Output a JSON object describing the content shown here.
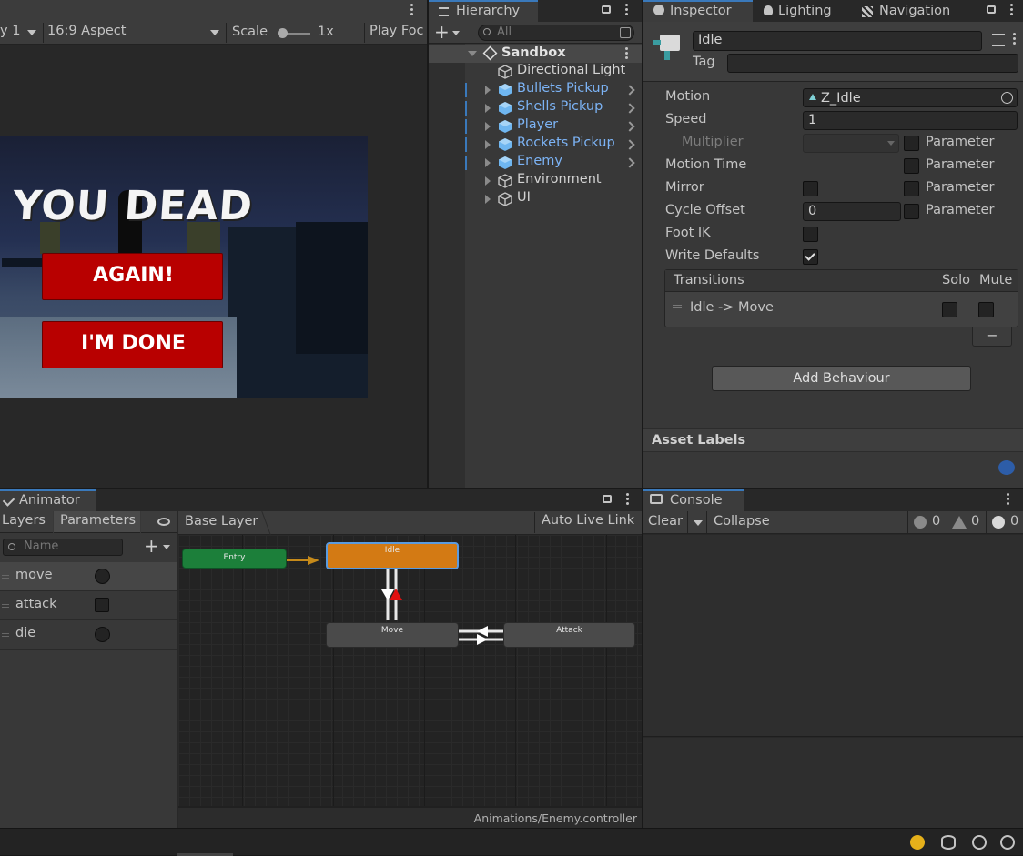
{
  "game_view": {
    "display_label": "y 1",
    "aspect_label": "16:9 Aspect",
    "scale_label": "Scale",
    "scale_value": "1x",
    "play_focus_label": "Play Foc",
    "title_text": "YOU DEAD",
    "again_label": "AGAIN!",
    "done_label": "I'M DONE"
  },
  "hierarchy": {
    "tab_label": "Hierarchy",
    "search_placeholder": "All",
    "scene_name": "Sandbox",
    "items": [
      {
        "label": "Directional Light",
        "prefab": false,
        "expandable": false,
        "chevron": false
      },
      {
        "label": "Bullets Pickup",
        "prefab": true,
        "expandable": true,
        "chevron": true
      },
      {
        "label": "Shells Pickup",
        "prefab": true,
        "expandable": true,
        "chevron": true
      },
      {
        "label": "Player",
        "prefab": true,
        "expandable": true,
        "chevron": true
      },
      {
        "label": "Rockets Pickup",
        "prefab": true,
        "expandable": true,
        "chevron": true
      },
      {
        "label": "Enemy",
        "prefab": true,
        "expandable": true,
        "chevron": true
      },
      {
        "label": "Environment",
        "prefab": false,
        "expandable": true,
        "chevron": false
      },
      {
        "label": "UI",
        "prefab": false,
        "expandable": true,
        "chevron": false
      }
    ]
  },
  "inspector": {
    "tabs": [
      "Inspector",
      "Lighting",
      "Navigation"
    ],
    "name_value": "Idle",
    "tag_label": "Tag",
    "motion_label": "Motion",
    "motion_value": "Z_Idle",
    "speed_label": "Speed",
    "speed_value": "1",
    "multiplier_label": "Multiplier",
    "motion_time_label": "Motion Time",
    "mirror_label": "Mirror",
    "cycle_offset_label": "Cycle Offset",
    "cycle_offset_value": "0",
    "foot_ik_label": "Foot IK",
    "write_defaults_label": "Write Defaults",
    "write_defaults_checked": true,
    "parameter_label": "Parameter",
    "transitions_header": "Transitions",
    "solo_label": "Solo",
    "mute_label": "Mute",
    "transition_item": "Idle -> Move",
    "remove_label": "−",
    "add_behaviour_label": "Add Behaviour",
    "asset_labels_header": "Asset Labels"
  },
  "animator": {
    "tab_label": "Animator",
    "layers_tab": "Layers",
    "parameters_tab": "Parameters",
    "search_placeholder": "Name",
    "breadcrumb": "Base Layer",
    "auto_live_link": "Auto Live Link",
    "parameters": [
      {
        "name": "move",
        "type": "trigger"
      },
      {
        "name": "attack",
        "type": "bool"
      },
      {
        "name": "die",
        "type": "trigger"
      }
    ],
    "states": {
      "entry": "Entry",
      "idle": "Idle",
      "move": "Move",
      "attack": "Attack"
    },
    "footer_path": "Animations/Enemy.controller"
  },
  "console": {
    "tab_label": "Console",
    "clear_label": "Clear",
    "collapse_label": "Collapse",
    "error_count": "0",
    "warning_count": "0",
    "log_count": "0"
  },
  "colors": {
    "panel_bg": "#383838",
    "panel_dark": "#282828",
    "header_bg": "#3c3c3c",
    "prefab_text": "#7cb3f5",
    "idle_state": "#d37a14",
    "entry_state": "#1c7f3a",
    "button_red": "#b80000"
  }
}
